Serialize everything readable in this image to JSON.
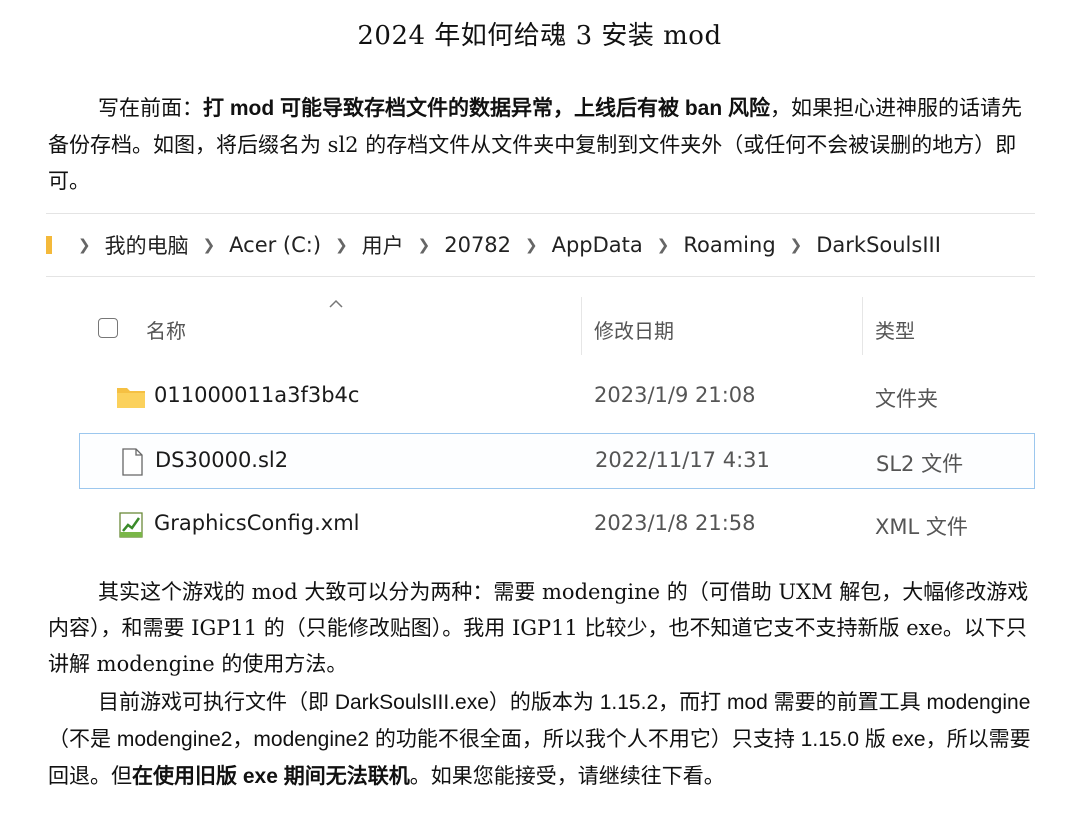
{
  "title": "2024 年如何给魂 3 安装 mod",
  "intro": {
    "lead": "写在前面：",
    "bold": "打 mod 可能导致存档文件的数据异常，上线后有被 ban 风险",
    "rest": "，如果担心进神服的话请先备份存档。如图，将后缀名为 sl2 的存档文件从文件夹中复制到文件夹外（或任何不会被误删的地方）即可。"
  },
  "explorer": {
    "breadcrumb": [
      "我的电脑",
      "Acer (C:)",
      "用户",
      "20782",
      "AppData",
      "Roaming",
      "DarkSoulsIII"
    ],
    "columns": {
      "name": "名称",
      "date": "修改日期",
      "type": "类型"
    },
    "files": [
      {
        "icon": "folder-icon",
        "name": "011000011a3f3b4c",
        "date": "2023/1/9 21:08",
        "type": "文件夹"
      },
      {
        "icon": "file-icon",
        "name": "DS30000.sl2",
        "date": "2022/11/17 4:31",
        "type": "SL2 文件"
      },
      {
        "icon": "xml-file-icon",
        "name": "GraphicsConfig.xml",
        "date": "2023/1/8 21:58",
        "type": "XML 文件"
      }
    ]
  },
  "para2": "其实这个游戏的 mod 大致可以分为两种：需要 modengine 的（可借助 UXM 解包，大幅修改游戏内容），和需要 IGP11 的（只能修改贴图）。我用 IGP11 比较少，也不知道它支不支持新版 exe。以下只讲解 modengine 的使用方法。",
  "para3": {
    "part1": "目前游戏可执行文件（即 DarkSoulsIII.exe）的版本为 1.15.2，而打 mod 需要的前置工具 modengine（不是 modengine2，modengine2 的功能不很全面，所以我个人不用它）只支持 1.15.0 版 exe，所以需要回退。但",
    "bold": "在使用旧版 exe 期间无法联机",
    "part2": "。如果您能接受，请继续往下看。"
  }
}
